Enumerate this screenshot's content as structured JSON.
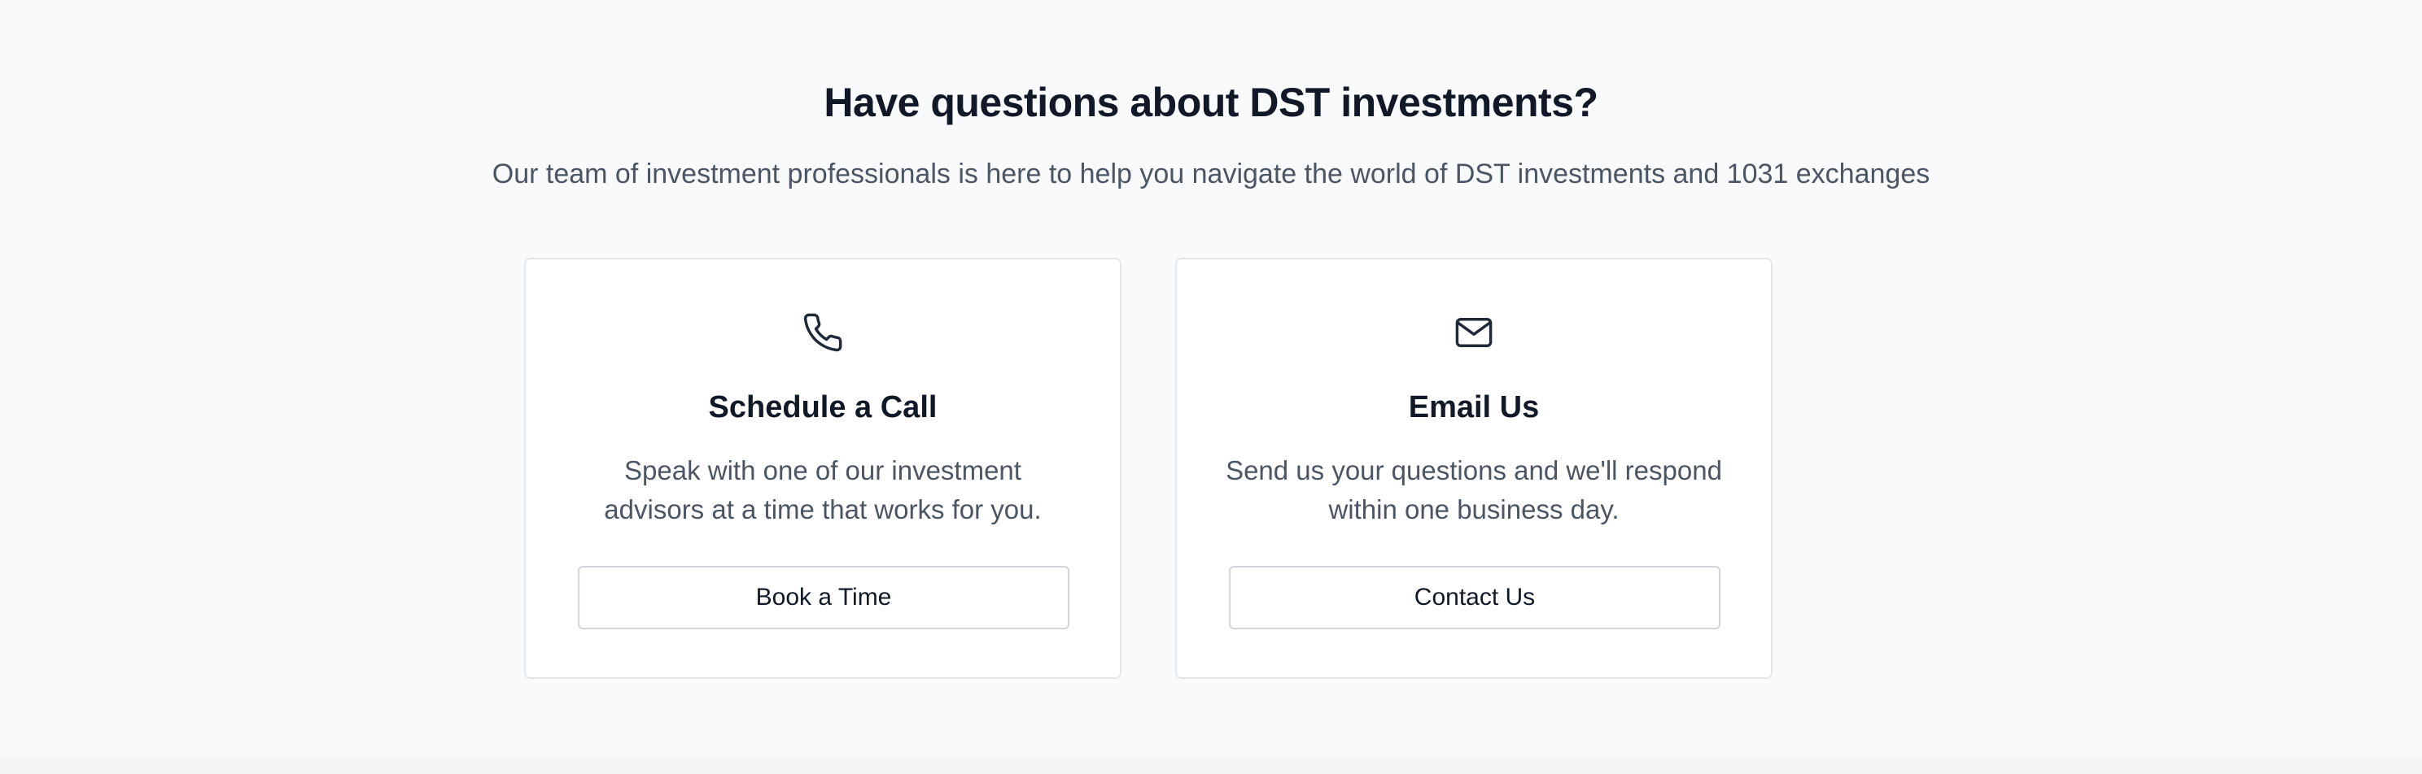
{
  "header": {
    "title": "Have questions about DST investments?",
    "subtitle": "Our team of investment professionals is here to help you navigate the world of DST investments and 1031 exchanges"
  },
  "cards": [
    {
      "icon": "phone-icon",
      "title": "Schedule a Call",
      "description": "Speak with one of our investment advisors at a time that works for you.",
      "button_label": "Book a Time"
    },
    {
      "icon": "mail-icon",
      "title": "Email Us",
      "description": "Send us your questions and we'll respond within one business day.",
      "button_label": "Contact Us"
    }
  ],
  "colors": {
    "background": "#f9fafb",
    "heading": "#111827",
    "body_text": "#4b5563",
    "card_border": "#e5e7eb",
    "button_border": "#d1d5db",
    "icon_stroke": "#1f2937"
  }
}
